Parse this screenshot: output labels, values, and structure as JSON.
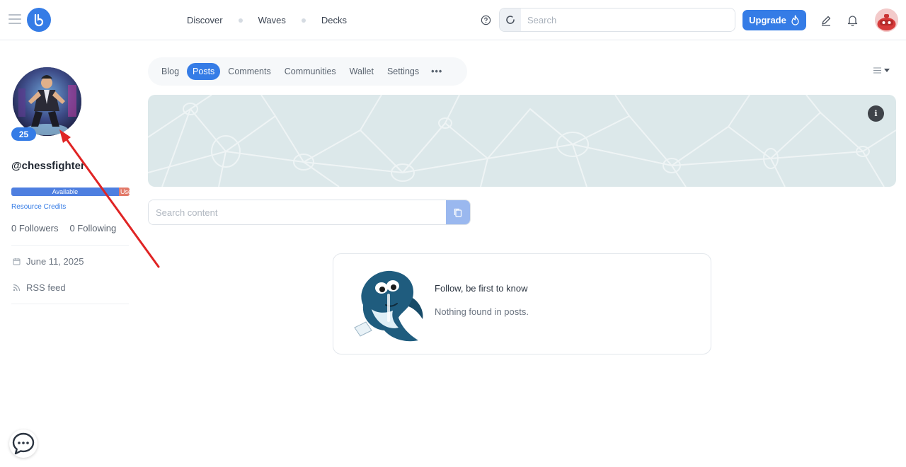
{
  "header": {
    "nav": [
      "Discover",
      "Waves",
      "Decks"
    ],
    "search_placeholder": "Search",
    "upgrade_label": "Upgrade",
    "icons": [
      "menu-icon",
      "logo-icon",
      "help-icon",
      "loading-icon",
      "fire-icon",
      "pencil-icon",
      "bell-icon",
      "avatar"
    ]
  },
  "profile": {
    "reputation": "25",
    "username": "@chessfighter",
    "resource_credits": {
      "available_label": "Available",
      "used_label": "Used",
      "available_fraction": 0.91,
      "link_label": "Resource Credits"
    },
    "followers": "0 Followers",
    "following": "0 Following",
    "joined": "June 11, 2025",
    "rss": "RSS feed"
  },
  "tabs": {
    "items": [
      "Blog",
      "Posts",
      "Comments",
      "Communities",
      "Wallet",
      "Settings"
    ],
    "active": "Posts",
    "more": "•••"
  },
  "cover": {
    "info_label": "i",
    "color": "#dce8ea"
  },
  "content_search": {
    "placeholder": "Search content"
  },
  "empty_state": {
    "title": "Follow, be first to know",
    "subtitle": "Nothing found in posts."
  },
  "colors": {
    "accent": "#357ce6",
    "annotation_arrow": "#e02424"
  }
}
